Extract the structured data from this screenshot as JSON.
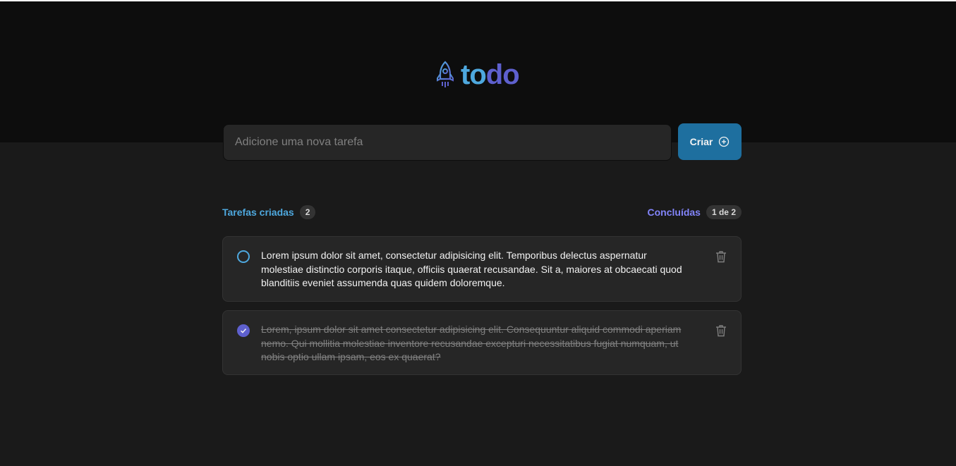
{
  "app": {
    "logo_part1": "to",
    "logo_part2": "do",
    "colors": {
      "blue": "#4ea8de",
      "purple": "#5e60ce",
      "purple_light": "#8284fa",
      "button": "#1e6f9f"
    }
  },
  "new_task": {
    "placeholder": "Adicione uma nova tarefa",
    "value": "",
    "create_label": "Criar",
    "create_icon": "plus-circle-icon"
  },
  "counters": {
    "created_label": "Tarefas criadas",
    "created_count": "2",
    "done_label": "Concluídas",
    "done_count": "1 de 2"
  },
  "tasks": [
    {
      "text": "Lorem ipsum dolor sit amet, consectetur adipisicing elit. Temporibus delectus aspernatur molestiae distinctio corporis itaque, officiis quaerat recusandae. Sit a, maiores at obcaecati quod blanditiis eveniet assumenda quas quidem doloremque.",
      "completed": false
    },
    {
      "text": "Lorem, ipsum dolor sit amet consectetur adipisicing elit. Consequuntur aliquid commodi aperiam nemo. Qui mollitia molestiae inventore recusandae excepturi necessitatibus fugiat numquam, ut nobis optio ullam ipsam, eos ex quaerat?",
      "completed": true
    }
  ]
}
